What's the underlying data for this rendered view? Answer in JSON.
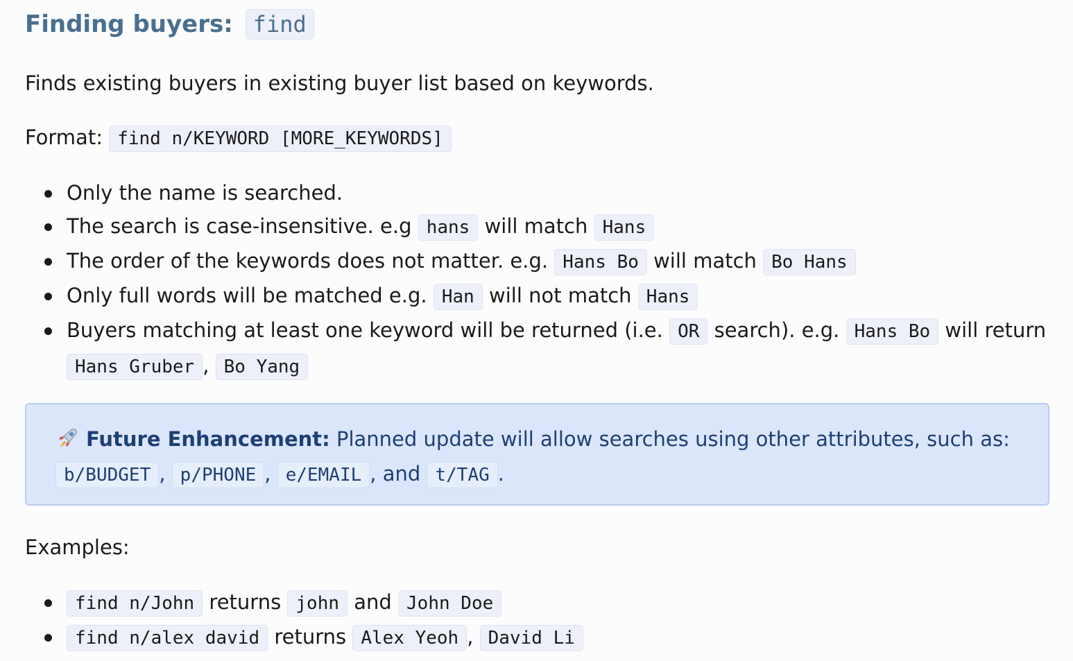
{
  "heading": {
    "title": "Finding buyers:",
    "command": "find"
  },
  "description": "Finds existing buyers in existing buyer list based on keywords.",
  "format": {
    "label": "Format:",
    "syntax": "find n/KEYWORD [MORE_KEYWORDS]"
  },
  "rules": [
    {
      "text1": "Only the name is searched."
    },
    {
      "text1": "The search is case-insensitive. e.g",
      "code1": "hans",
      "text2": "will match",
      "code2": "Hans"
    },
    {
      "text1": "The order of the keywords does not matter. e.g.",
      "code1": "Hans Bo",
      "text2": "will match",
      "code2": "Bo Hans"
    },
    {
      "text1": "Only full words will be matched e.g.",
      "code1": "Han",
      "text2": "will not match",
      "code2": "Hans"
    },
    {
      "text1": "Buyers matching at least one keyword will be returned (i.e.",
      "code1": "OR",
      "text2": "search). e.g.",
      "code2": "Hans Bo",
      "text3": "will return",
      "code3": "Hans Gruber",
      "sep": ",",
      "code4": "Bo Yang"
    }
  ],
  "callout": {
    "icon": "rocket-icon",
    "title": "Future Enhancement:",
    "text": "Planned update will allow searches using other attributes, such as:",
    "codes": [
      "b/BUDGET",
      "p/PHONE",
      "e/EMAIL",
      "t/TAG"
    ],
    "sep": ",",
    "and_text": ", and",
    "end": ".",
    "bg_color": "#dbe6fb",
    "text_color": "#1f3f73"
  },
  "examples": {
    "label": "Examples:",
    "items": [
      {
        "code1": "find n/John",
        "text1": "returns",
        "code2": "john",
        "text2": "and",
        "code3": "John Doe"
      },
      {
        "code1": "find n/alex david",
        "text1": "returns",
        "code2": "Alex Yeoh",
        "sep": ",",
        "code3": "David Li"
      }
    ]
  },
  "colors": {
    "heading": "#4a6f8f",
    "code_bg": "#eef0f9"
  }
}
